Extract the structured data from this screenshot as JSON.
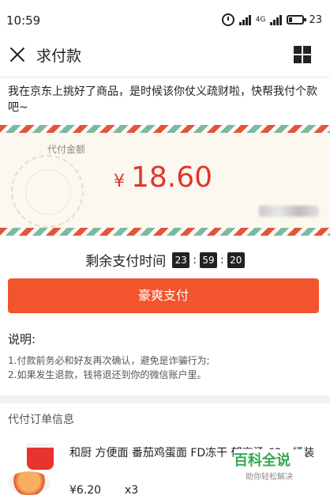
{
  "status_bar": {
    "time": "10:59",
    "network": "4G",
    "battery": "23"
  },
  "nav": {
    "title": "求付款"
  },
  "message": "我在京东上挑好了商品，是时候该你仗义疏财啦，快帮我付个款吧~",
  "card": {
    "label": "代付金额",
    "currency": "¥",
    "amount": "18.60"
  },
  "countdown": {
    "label": "剩余支付时间",
    "hours": "23",
    "minutes": "59",
    "seconds": "20",
    "sep": ":"
  },
  "pay_button": "豪爽支付",
  "notes": {
    "title": "说明:",
    "lines": [
      "1.付款前务必和好友再次确认，避免是诈骗行为;",
      "2.如果发生退款，钱将退还到你的微信账户里。"
    ]
  },
  "order_section": {
    "title": "代付订单信息"
  },
  "product": {
    "name": "和厨 方便面 番茄鸡蛋面 FD冻干  郁高汤 62g 桶装",
    "price": "¥6.20",
    "qty": "x3"
  },
  "watermark": {
    "title": "百科全说",
    "subtitle": "助你轻松解决"
  },
  "colors": {
    "accent": "#f2542d",
    "amount": "#e2352c",
    "card_bg": "#fcf8ef"
  }
}
